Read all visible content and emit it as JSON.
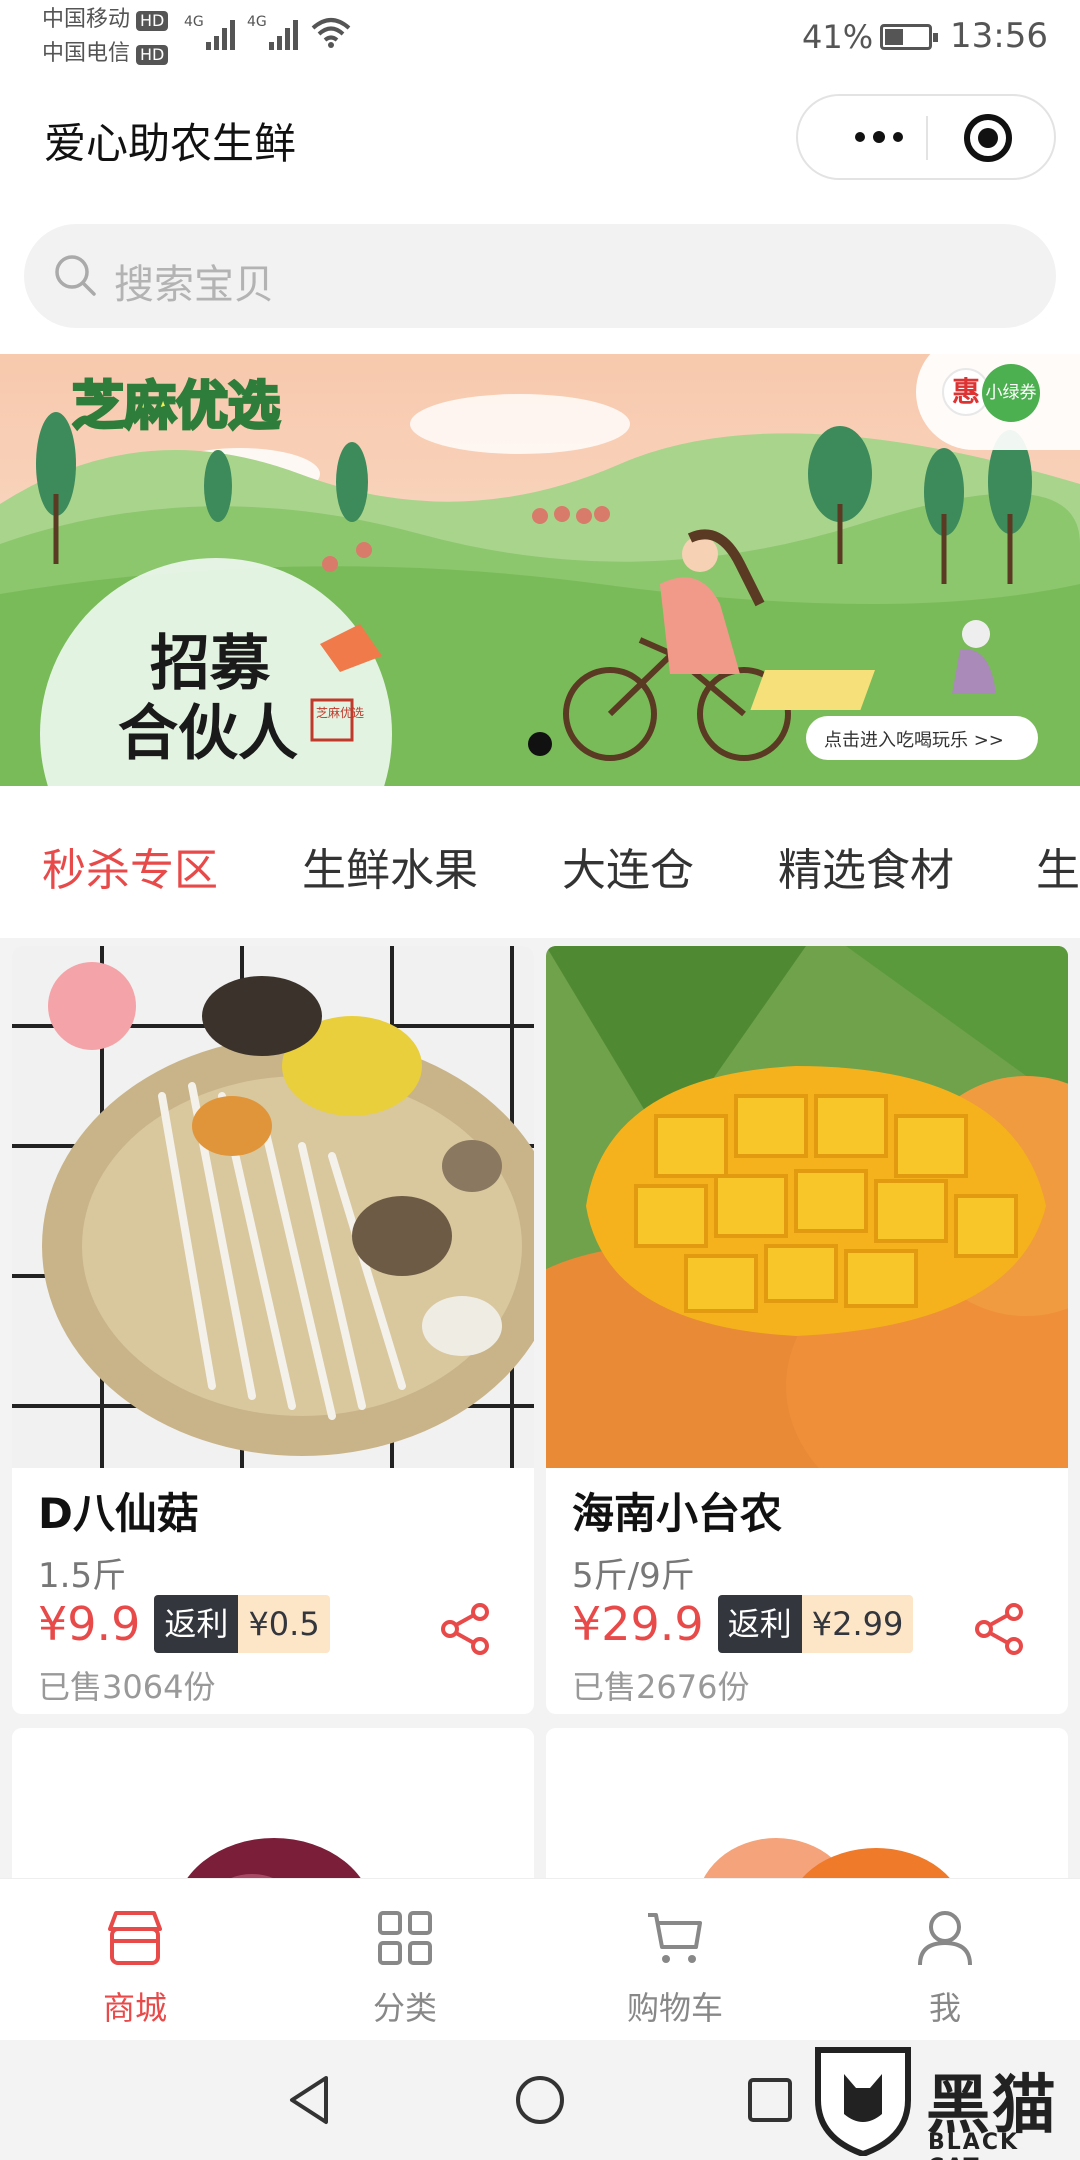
{
  "status_bar": {
    "carrier_1": "中国移动",
    "carrier_2": "中国电信",
    "hd": "HD",
    "network_1": "4G",
    "network_2": "4G",
    "battery": "41%",
    "battery_level": 0.41,
    "time": "13:56"
  },
  "header": {
    "title": "爱心助农生鲜"
  },
  "search": {
    "placeholder": "搜索宝贝"
  },
  "banner": {
    "brand": "芝麻优选",
    "headline_1": "招募",
    "headline_2": "合伙人",
    "seal": "芝麻优选",
    "cta": "点击进入吃喝玩乐 >>",
    "coupon_badge": "小绿券",
    "coupon_icon_letter": "惠"
  },
  "tabs": [
    {
      "label": "秒杀专区",
      "active": true
    },
    {
      "label": "生鲜水果",
      "active": false
    },
    {
      "label": "大连仓",
      "active": false
    },
    {
      "label": "精选食材",
      "active": false
    },
    {
      "label": "生",
      "active": false
    }
  ],
  "products": [
    {
      "name": "D八仙菇",
      "spec": "1.5斤",
      "price": "¥9.9",
      "rebate_label": "返利",
      "rebate_value": "¥0.5",
      "sold": "已售3064份"
    },
    {
      "name": "海南小台农",
      "spec": "5斤/9斤",
      "price": "¥29.9",
      "rebate_label": "返利",
      "rebate_value": "¥2.99",
      "sold": "已售2676份"
    }
  ],
  "tabbar": [
    {
      "label": "商城",
      "icon": "store-icon",
      "active": true
    },
    {
      "label": "分类",
      "icon": "grid-icon",
      "active": false
    },
    {
      "label": "购物车",
      "icon": "cart-icon",
      "active": false
    },
    {
      "label": "我",
      "icon": "person-icon",
      "active": false
    }
  ],
  "watermark": {
    "zh": "黑猫",
    "en": "BLACK CAT"
  },
  "colors": {
    "accent": "#e84a4a",
    "rebate_dark": "#33373d",
    "rebate_light": "#fde5c8"
  }
}
